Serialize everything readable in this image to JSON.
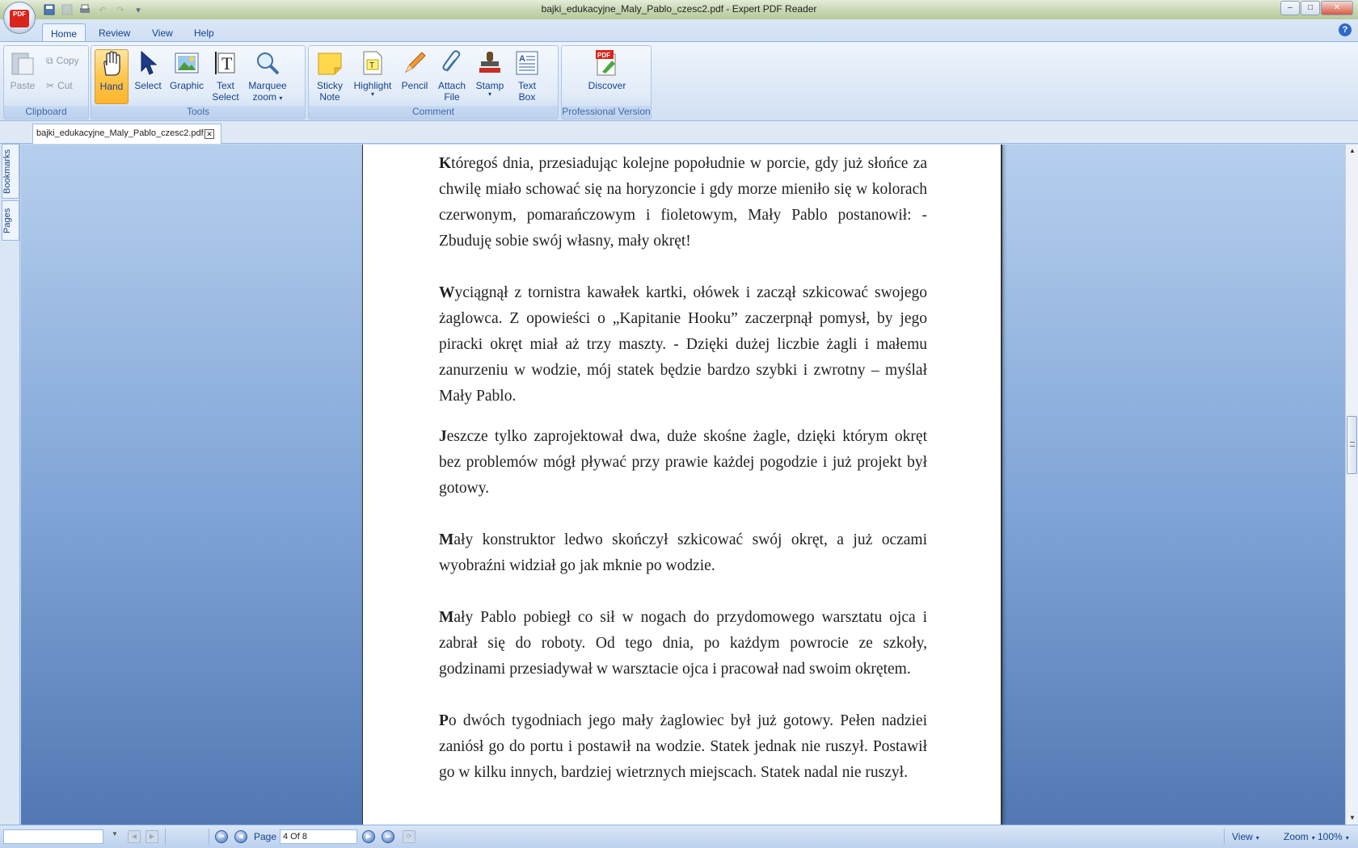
{
  "window": {
    "title": "bajki_edukacyjne_Maly_Pablo_czesc2.pdf - Expert PDF Reader",
    "app_icon": "pdf-orb-icon",
    "logo_text": "PDF",
    "controls": {
      "minimize": "–",
      "maximize": "□",
      "close": "✕"
    }
  },
  "quick_access": [
    "save-icon",
    "save-disabled-icon",
    "print-icon",
    "undo-icon",
    "redo-icon",
    "customize-icon"
  ],
  "ribbon_tabs": [
    "Home",
    "Review",
    "View",
    "Help"
  ],
  "active_tab": "Home",
  "ribbon": {
    "clipboard": {
      "label": "Clipboard",
      "paste": "Paste",
      "copy": "Copy",
      "cut": "Cut"
    },
    "tools": {
      "label": "Tools",
      "hand": "Hand",
      "select": "Select",
      "graphic": "Graphic",
      "text_select_1": "Text",
      "text_select_2": "Select",
      "marquee_1": "Marquee",
      "marquee_2": "zoom"
    },
    "comment": {
      "label": "Comment",
      "sticky_1": "Sticky",
      "sticky_2": "Note",
      "highlight": "Highlight",
      "pencil": "Pencil",
      "attach_1": "Attach",
      "attach_2": "File",
      "stamp": "Stamp",
      "textbox_1": "Text",
      "textbox_2": "Box"
    },
    "professional": {
      "label": "Professional Version",
      "discover": "Discover"
    }
  },
  "document_tab": {
    "filename": "bajki_edukacyjne_Maly_Pablo_czesc2.pdf",
    "close": "✕"
  },
  "side_panel": {
    "bookmarks": "Bookmarks",
    "pages": "Pages"
  },
  "page_content": {
    "p1_initial": "K",
    "p1": "tóregoś dnia, przesiadując kolejne popołudnie w porcie, gdy już słońce za chwilę miało schować się na horyzoncie i gdy morze mieniło się w kolorach czerwonym, pomarańczowym i fioletowym, Mały Pablo postanowił: - Zbuduję sobie swój własny, mały okręt!",
    "p2_initial": "W",
    "p2": "yciągnął z tornistra kawałek kartki, ołówek i zaczął szkicować swojego żaglowca. Z opowieści o „Kapitanie Hooku” zaczerpnął pomysł, by jego piracki okręt miał aż trzy maszty. - Dzięki dużej liczbie żagli i małemu zanurzeniu w wodzie, mój statek będzie bardzo szybki i zwrotny – myślał Mały Pablo.",
    "p3_initial": "J",
    "p3": "eszcze tylko zaprojektował dwa, duże skośne żagle, dzięki którym okręt bez problemów mógł pływać przy prawie każdej pogodzie i już projekt był gotowy.",
    "p4_initial": "M",
    "p4": "ały konstruktor ledwo skończył szkicować swój okręt, a już oczami wyobraźni widział go jak mknie po wodzie.",
    "p5_initial": "M",
    "p5": "ały Pablo pobiegł co sił w nogach do przydomowego warsztatu ojca i zabrał się do roboty. Od tego dnia, po każdym powrocie ze szkoły, godzinami przesiadywał w warsztacie ojca i pracował nad swoim okrętem.",
    "p6_initial": "P",
    "p6": "o dwóch tygodniach jego mały żaglowiec był już gotowy. Pełen nadziei zaniósł go do portu i postawił na wodzie. Statek jednak nie ruszył. Postawił go w kilku innych, bardziej wietrznych miejscach. Statek nadal nie ruszył."
  },
  "statusbar": {
    "page_label": "Page",
    "page_value": "4 Of 8",
    "view": "View",
    "zoom": "Zoom",
    "zoom_level": "100%"
  },
  "colors": {
    "accent": "#15428b",
    "active_tool": "#ffc64d",
    "doc_bg_top": "#b6cfee",
    "doc_bg_bottom": "#5278b4"
  }
}
